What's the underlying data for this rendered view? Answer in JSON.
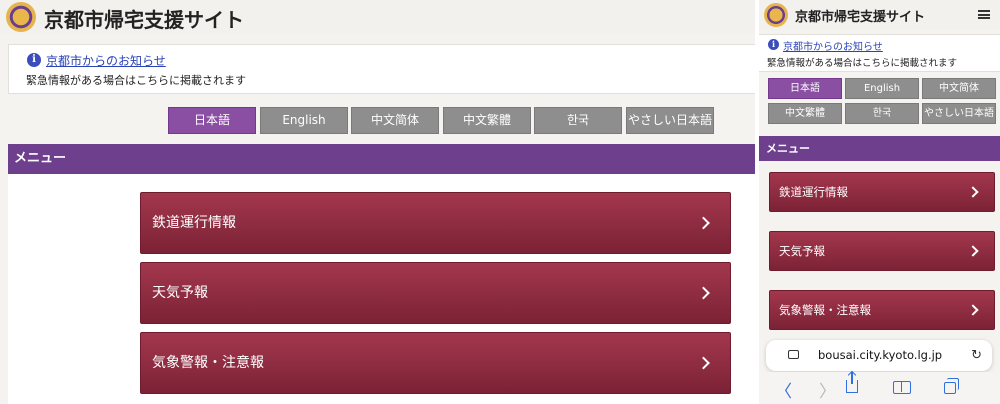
{
  "site": {
    "title": "京都市帰宅支援サイト"
  },
  "notice": {
    "link": "京都市からのお知らせ",
    "text": "緊急情報がある場合はこちらに掲載されます",
    "icon": "info-icon"
  },
  "languages": [
    {
      "label": "日本語",
      "active": true
    },
    {
      "label": "English",
      "active": false
    },
    {
      "label": "中文简体",
      "active": false
    },
    {
      "label": "中文繁體",
      "active": false
    },
    {
      "label": "한국",
      "active": false
    },
    {
      "label": "やさしい日本語",
      "active": false
    }
  ],
  "menu": {
    "title": "メニュー",
    "items": [
      {
        "label": "鉄道運行情報"
      },
      {
        "label": "天気予報"
      },
      {
        "label": "気象警報・注意報"
      }
    ]
  },
  "browser": {
    "url": "bousai.city.kyoto.lg.jp"
  },
  "colors": {
    "accent_purple": "#6d3f8d",
    "menu_item": "#8f2b41",
    "lang_active": "#8a4ea3",
    "lang_inactive": "#8e8e8e",
    "link_blue": "#2a43b8"
  }
}
